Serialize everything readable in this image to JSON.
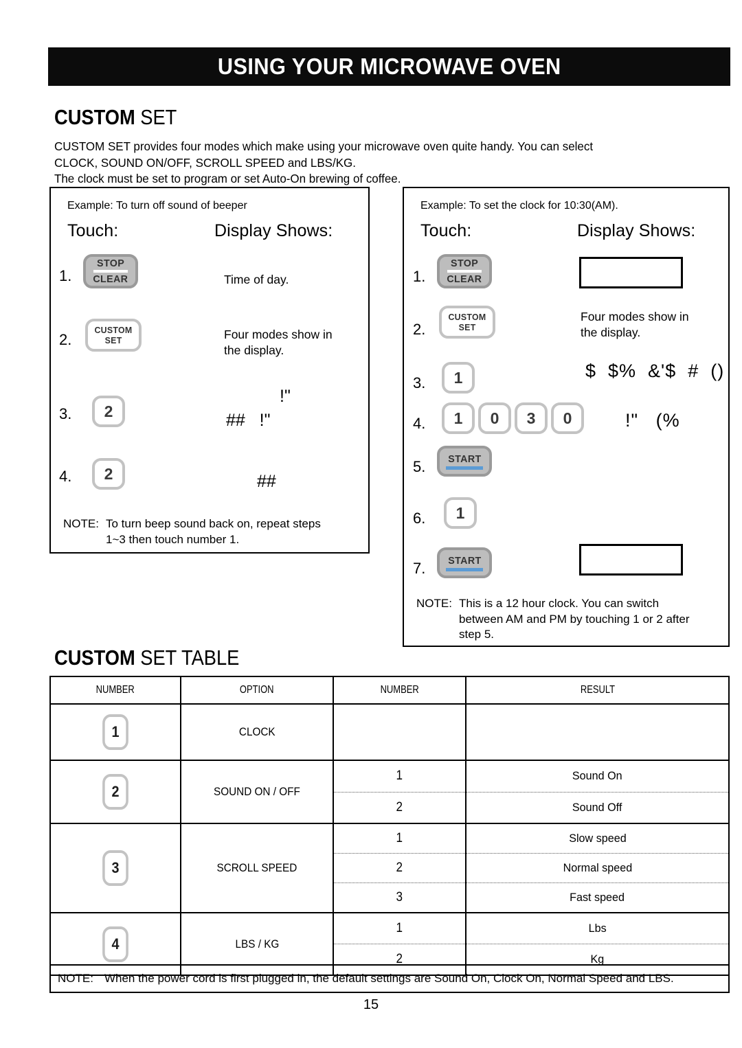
{
  "header": {
    "title": "USING YOUR MICROWAVE OVEN"
  },
  "section": {
    "custom_set_bold": "CUSTOM",
    "custom_set_regular": " SET",
    "custom_set_table_bold": "CUSTOM",
    "custom_set_table_regular": " SET TABLE"
  },
  "intro": {
    "line1": "CUSTOM SET provides four modes which make using your microwave oven quite handy. You can select",
    "line2": "CLOCK, SOUND ON/OFF, SCROLL SPEED and LBS/KG.",
    "line3": "The clock must be set to program or set  Auto-On  brewing of coffee."
  },
  "example_left": {
    "caption": "Example: To turn off sound of beeper",
    "touch_label": "Touch:",
    "display_label": "Display Shows:",
    "steps": [
      {
        "number": "1.",
        "buttons": [
          {
            "type": "stop-clear",
            "line1": "STOP",
            "line2": "CLEAR"
          }
        ],
        "display": "Time of day."
      },
      {
        "number": "2.",
        "buttons": [
          {
            "type": "custom-set",
            "line1": "CUSTOM",
            "line2": "SET"
          }
        ],
        "display_line1": "Four modes show in",
        "display_line2": "the display."
      },
      {
        "number": "3.",
        "buttons": [
          {
            "type": "digit",
            "label": "2"
          }
        ],
        "glyph_top": "!\"",
        "glyph_bottom": "##   !\""
      },
      {
        "number": "4.",
        "buttons": [
          {
            "type": "digit",
            "label": "2"
          }
        ],
        "glyph": "##"
      }
    ],
    "note_label": "NOTE:",
    "note_line1": "To turn beep sound back on, repeat steps",
    "note_line2": "1~3 then touch number 1."
  },
  "example_right": {
    "caption": "Example: To set the clock for 10:30(AM).",
    "touch_label": "Touch:",
    "display_label": "Display Shows:",
    "steps": [
      {
        "number": "1.",
        "buttons": [
          {
            "type": "stop-clear",
            "line1": "STOP",
            "line2": "CLEAR"
          }
        ],
        "display": ""
      },
      {
        "number": "2.",
        "buttons": [
          {
            "type": "custom-set",
            "line1": "CUSTOM",
            "line2": "SET"
          }
        ],
        "display_line1": "Four modes show in",
        "display_line2": "the display."
      },
      {
        "number": "3.",
        "buttons": [
          {
            "type": "digit",
            "label": "1"
          }
        ],
        "glyph": "$  $%  &'$  #  ()"
      },
      {
        "number": "4.",
        "buttons": [
          {
            "type": "digit",
            "label": "1"
          },
          {
            "type": "digit",
            "label": "0"
          },
          {
            "type": "digit",
            "label": "3"
          },
          {
            "type": "digit",
            "label": "0"
          }
        ],
        "glyph": "!\"   (%"
      },
      {
        "number": "5.",
        "buttons": [
          {
            "type": "start",
            "line1": "START"
          }
        ],
        "display": ""
      },
      {
        "number": "6.",
        "buttons": [
          {
            "type": "digit",
            "label": "1"
          }
        ],
        "display": ""
      },
      {
        "number": "7.",
        "buttons": [
          {
            "type": "start",
            "line1": "START"
          }
        ],
        "display": ""
      }
    ],
    "note_label": "NOTE:",
    "note_line1": "This is a 12 hour clock. You can switch",
    "note_line2": "between AM and PM by touching 1 or 2 after",
    "note_line3": "step 5."
  },
  "table": {
    "headers": {
      "number1": "NUMBER",
      "option": "OPTION",
      "number2": "NUMBER",
      "result": "RESULT"
    },
    "rows": [
      {
        "key": "1",
        "option": "CLOCK",
        "entries": [
          {
            "number": "",
            "result": ""
          }
        ]
      },
      {
        "key": "2",
        "option": "SOUND ON / OFF",
        "entries": [
          {
            "number": "1",
            "result": "Sound On"
          },
          {
            "number": "2",
            "result": "Sound Off"
          }
        ]
      },
      {
        "key": "3",
        "option": "SCROLL SPEED",
        "entries": [
          {
            "number": "1",
            "result": "Slow speed"
          },
          {
            "number": "2",
            "result": "Normal speed"
          },
          {
            "number": "3",
            "result": "Fast speed"
          }
        ]
      },
      {
        "key": "4",
        "option": "LBS / KG",
        "entries": [
          {
            "number": "1",
            "result": "Lbs"
          },
          {
            "number": "2",
            "result": "Kg"
          }
        ]
      }
    ],
    "note_label": "NOTE:",
    "note_text": "When the power cord is first plugged in, the default settings are Sound On, Clock On, Normal Speed and LBS."
  },
  "footer": {
    "page_number": "15"
  },
  "colors": {
    "header_bg": "#0c0c0c",
    "button_gray_fill": "#bdbdbd",
    "button_gray_border": "#9a9a9a",
    "button_white_border": "#c3c3c3",
    "start_accent": "#5b9bd5"
  }
}
